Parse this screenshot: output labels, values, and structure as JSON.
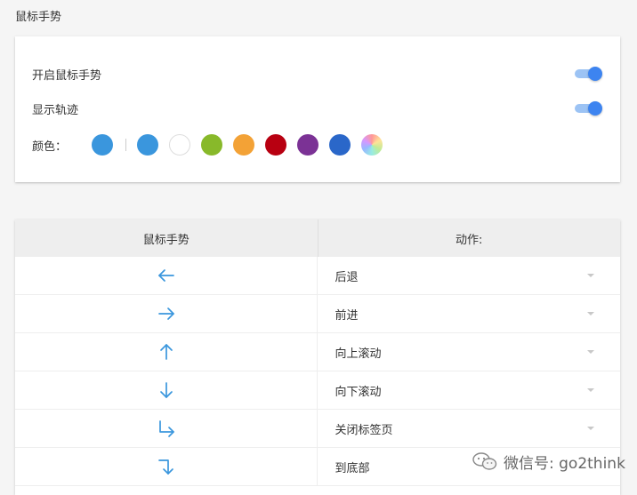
{
  "header": {
    "title": "鼠标手势"
  },
  "settings": {
    "enable_label": "开启鼠标手势",
    "enable_on": true,
    "trail_label": "显示轨迹",
    "trail_on": true,
    "color_label": "颜色：",
    "current_color": "#3a96dd",
    "colors": [
      {
        "name": "blue",
        "hex": "#3a96dd"
      },
      {
        "name": "white",
        "hex": "#ffffff"
      },
      {
        "name": "green",
        "hex": "#88b92a"
      },
      {
        "name": "orange",
        "hex": "#f3a236"
      },
      {
        "name": "red",
        "hex": "#b80011"
      },
      {
        "name": "purple",
        "hex": "#7b3295"
      },
      {
        "name": "dark-blue",
        "hex": "#2a67c9"
      },
      {
        "name": "custom-rainbow",
        "hex": ""
      }
    ]
  },
  "table": {
    "col_gesture": "鼠标手势",
    "col_action": "动作:",
    "arrow_color": "#3a96dd",
    "rows": [
      {
        "gesture": "left-arrow-icon",
        "action": "后退"
      },
      {
        "gesture": "right-arrow-icon",
        "action": "前进"
      },
      {
        "gesture": "up-arrow-icon",
        "action": "向上滚动"
      },
      {
        "gesture": "down-arrow-icon",
        "action": "向下滚动"
      },
      {
        "gesture": "down-right-arrow-icon",
        "action": "关闭标签页"
      },
      {
        "gesture": "right-down-arrow-icon",
        "action": "到底部"
      }
    ]
  },
  "watermark": {
    "text": "微信号: go2think"
  }
}
